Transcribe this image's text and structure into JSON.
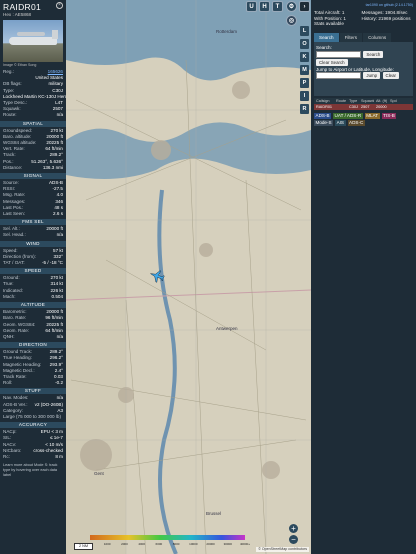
{
  "left": {
    "callsign": "RAIDR01",
    "hex": "Hex : AE5868",
    "photo_credit": "Image © Ethan Song",
    "close": "×",
    "basic": [
      {
        "k": "Reg.:",
        "v": "165626",
        "link": true
      },
      {
        "k": "",
        "v": "United States"
      },
      {
        "k": "DB flags:",
        "v": "military"
      },
      {
        "k": "Type:",
        "v": "C30J"
      },
      {
        "k": "",
        "v": "Lockheed Martin KC-130J Hercules"
      },
      {
        "k": "Type Desc.:",
        "v": "L4T"
      },
      {
        "k": "Squawk:",
        "v": "2507"
      },
      {
        "k": "Route:",
        "v": "n/a"
      }
    ],
    "sections": [
      {
        "title": "SPATIAL",
        "rows": [
          {
            "k": "Groundspeed:",
            "v": "270 kt"
          },
          {
            "k": "Baro. altitude:",
            "v": "20000 ft"
          },
          {
            "k": "WGS84 altitude:",
            "v": "20225 ft"
          },
          {
            "k": "Vert. Rate:",
            "v": "64 ft/min"
          },
          {
            "k": "Track:",
            "v": "289.2°"
          },
          {
            "k": "Pos.:",
            "v": "51.263°, 5.636°"
          },
          {
            "k": "Distance:",
            "v": "136.3 nmi"
          }
        ]
      },
      {
        "title": "SIGNAL",
        "rows": [
          {
            "k": "Source:",
            "v": "ADS-B"
          },
          {
            "k": "RSSI:",
            "v": "-27.5"
          },
          {
            "k": "Msg. Rate:",
            "v": "4.0"
          },
          {
            "k": "Messages:",
            "v": "346"
          },
          {
            "k": "Last Pos.:",
            "v": "48 s"
          },
          {
            "k": "Last Seen:",
            "v": "2.6 s"
          }
        ]
      },
      {
        "title": "FMS SEL",
        "rows": [
          {
            "k": "Sel. Alt.:",
            "v": "20000 ft"
          },
          {
            "k": "Sel. Head.:",
            "v": "n/a"
          }
        ]
      },
      {
        "title": "WIND",
        "rows": [
          {
            "k": "Speed:",
            "v": "57 kt"
          },
          {
            "k": "Direction (from):",
            "v": "332°"
          },
          {
            "k": "TAT / OAT:",
            "v": "-5 / -18 °C"
          }
        ]
      },
      {
        "title": "SPEED",
        "rows": [
          {
            "k": "Ground:",
            "v": "270 kt"
          },
          {
            "k": "True:",
            "v": "314 kt"
          },
          {
            "k": "Indicated:",
            "v": "226 kt"
          },
          {
            "k": "Mach:",
            "v": "0.504"
          }
        ]
      },
      {
        "title": "ALTITUDE",
        "rows": [
          {
            "k": "Barometric:",
            "v": "20000 ft"
          },
          {
            "k": "Baro. Rate:",
            "v": "96 ft/min"
          },
          {
            "k": "Geom. WGS84:",
            "v": "20225 ft"
          },
          {
            "k": "Geom. Rate:",
            "v": "64 ft/min"
          },
          {
            "k": "QNH:",
            "v": "n/a"
          }
        ]
      },
      {
        "title": "DIRECTION",
        "rows": [
          {
            "k": "Ground Track:",
            "v": "289.2°"
          },
          {
            "k": "True Heading:",
            "v": "296.2°"
          },
          {
            "k": "Magnetic Heading:",
            "v": "293.9°"
          },
          {
            "k": "Magnetic Decl.:",
            "v": "2.4°"
          },
          {
            "k": "Track Rate:",
            "v": "0.03"
          },
          {
            "k": "Roll:",
            "v": "-0.2"
          }
        ]
      },
      {
        "title": "STUFF",
        "rows": [
          {
            "k": "Nav. Modes:",
            "v": "n/a"
          },
          {
            "k": "ADS-B Ver.:",
            "v": "v2 (DO-260B)"
          },
          {
            "k": "Category:",
            "v": "A3"
          },
          {
            "k": "Large (75 000 to 300 000 lb)",
            "v": ""
          }
        ]
      },
      {
        "title": "ACCURACY",
        "rows": [
          {
            "k": "NACp:",
            "v": "EPU < 3 m"
          },
          {
            "k": "SIL:",
            "v": "≤ 1e-7"
          },
          {
            "k": "NACv:",
            "v": "< 10 m/s"
          },
          {
            "k": "NICbaro:",
            "v": "cross-checked"
          },
          {
            "k": "Rc:",
            "v": "8 m"
          }
        ]
      }
    ],
    "footer": "Learn more about Mode S: track type by hovering over each data label"
  },
  "map": {
    "buttons": [
      "U",
      "H",
      "T"
    ],
    "side_buttons": [
      "L",
      "O",
      "K",
      "M",
      "P",
      "I",
      "R"
    ],
    "zoom_in": "+",
    "zoom_out": "−",
    "scale": "2 NM",
    "attribution": "© OpenStreetMap contributors",
    "altitude_ticks": [
      "500",
      "1000",
      "2000",
      "4000",
      "6000",
      "8000",
      "10000",
      "20000",
      "30000",
      "40000+"
    ],
    "city_labels": [
      "Gent",
      "Antwerpen",
      "Rotterdam",
      "Brussel"
    ]
  },
  "right": {
    "top_link": "tar1090 on github (2.14.1750)",
    "stats": [
      {
        "a": "Total Aircraft: 1",
        "b": "Messages: 1904.8/sec"
      },
      {
        "a": "With Position: 1",
        "b": "History: 21969 positions"
      },
      {
        "a": "Stats available",
        "b": ""
      }
    ],
    "tabs": [
      "Search",
      "Filters",
      "Columns"
    ],
    "search_label": "Search:",
    "search_button": "Search",
    "clear_search": "Clear Search",
    "jump_label": "Jump to Airport or Latitude, Longitude:",
    "jump_button": "Jump",
    "clear_button": "Clear",
    "table_headers": [
      "Callsign",
      "Route",
      "Type",
      "Squawk",
      "Alt. (ft)",
      "Spd"
    ],
    "table_row": [
      "RAIDR01",
      "",
      "C30J",
      "2507",
      "20000",
      ""
    ],
    "legend": [
      {
        "t": "ADS-B",
        "c": "#2b4c8a"
      },
      {
        "t": "UAT / ADS-R",
        "c": "#3a6a2c"
      },
      {
        "t": "MLAT",
        "c": "#8a6a2c"
      },
      {
        "t": "TIS-B",
        "c": "#8a2c5a"
      },
      {
        "t": "Mode-S",
        "c": "#3a4a5a"
      },
      {
        "t": "AIS",
        "c": "#2a4a5a"
      },
      {
        "t": "ADS-C",
        "c": "#5a4a2c"
      }
    ]
  }
}
